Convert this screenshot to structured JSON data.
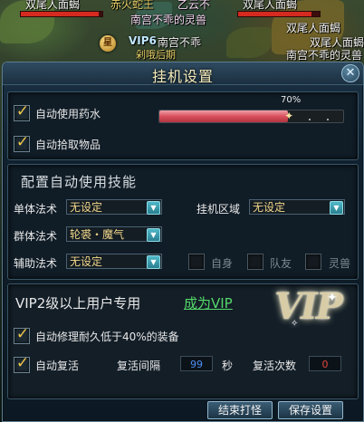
{
  "world": {
    "nameplates": [
      {
        "id": "enemy-1",
        "text": "双尾人面蝎"
      },
      {
        "id": "enemy-2",
        "text": "双尾人面蝎"
      },
      {
        "id": "enemy-3",
        "text": "双尾人面蝎"
      },
      {
        "id": "enemy-4",
        "text": "双尾人面蝎"
      },
      {
        "id": "pet-1",
        "text": "南宫不乖的灵兽"
      },
      {
        "id": "pet-2",
        "text": "南宫不乖的灵兽"
      },
      {
        "id": "enemy-5",
        "text": "双尾人面蝎"
      },
      {
        "id": "enemy-6",
        "text": "双尾人面蝎"
      },
      {
        "id": "enemy-7",
        "text": "双尾人面蝎"
      }
    ],
    "player": {
      "vip": "VIP6",
      "name": "南宫不乖",
      "title_fragment": "剁哦后期",
      "badge": "星"
    },
    "top_text_left": "赤火蛇王",
    "top_text_mid": "乙云不"
  },
  "dialog": {
    "title": "挂机设置",
    "close_symbol": "✕",
    "auto_potion": {
      "label": "自动使用药水",
      "checked": true,
      "threshold_percent": 70,
      "threshold_label": "70%"
    },
    "auto_pickup": {
      "label": "自动拾取物品",
      "checked": true
    },
    "skills": {
      "heading": "配置自动使用技能",
      "single_label": "单体法术",
      "single_value": "无设定",
      "area_label": "挂机区域",
      "area_value": "无设定",
      "group_label": "群体法术",
      "group_value": "轮裘・魔气",
      "support_label": "辅助法术",
      "support_value": "无设定",
      "targets": [
        {
          "label": "自身",
          "checked": false
        },
        {
          "label": "队友",
          "checked": false
        },
        {
          "label": "灵兽",
          "checked": false
        }
      ]
    },
    "vip": {
      "heading": "VIP2级以上用户专用",
      "link": "成为VIP",
      "logo_text": "VIP",
      "auto_repair": {
        "label": "自动修理耐久低于40%的装备",
        "checked": true
      },
      "auto_revive": {
        "label": "自动复活",
        "checked": true
      },
      "revive_interval_label": "复活间隔",
      "revive_interval_value": "99",
      "revive_interval_unit": "秒",
      "revive_count_label": "复活次数",
      "revive_count_value": "0"
    },
    "buttons": {
      "end": "结束打怪",
      "save": "保存设置"
    }
  },
  "colors": {
    "accent_gold": "#f0c64a",
    "link_green": "#55d86a",
    "bar_red": "#d8505c"
  }
}
